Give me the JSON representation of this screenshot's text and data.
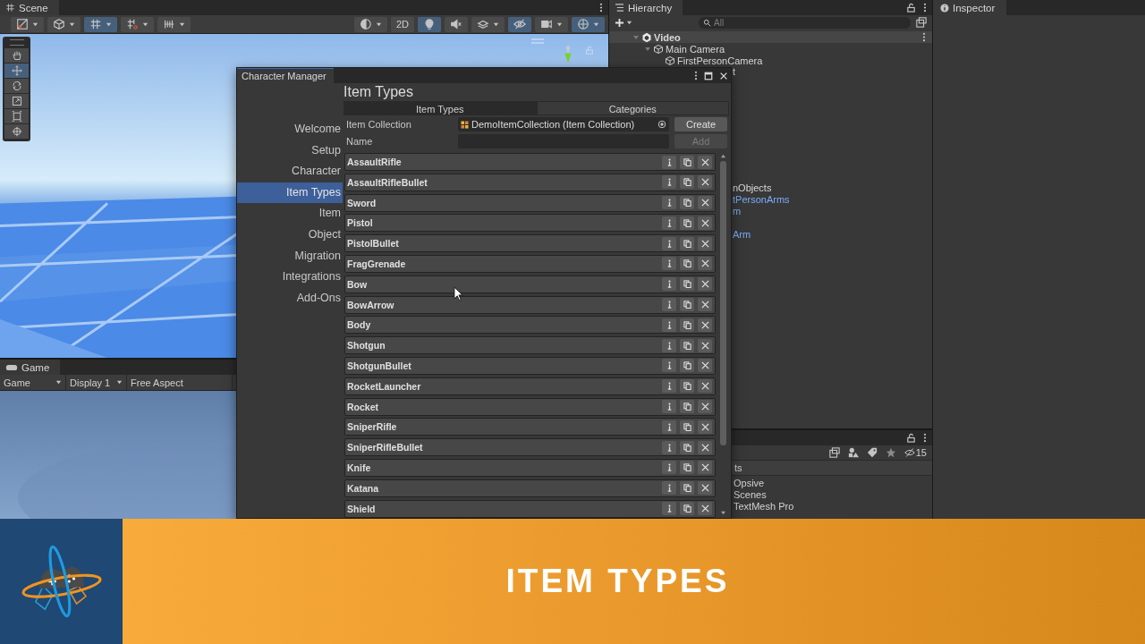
{
  "scene_panel": {
    "tab": "Scene",
    "toolbar": [
      {
        "kind": "icon",
        "dropdown": true,
        "on": false
      },
      {
        "kind": "icon",
        "dropdown": true,
        "on": false
      },
      {
        "kind": "icon",
        "dropdown": true,
        "on": true
      },
      {
        "kind": "icon",
        "dropdown": true,
        "on": false
      },
      {
        "kind": "icon",
        "dropdown": true,
        "on": false
      },
      {
        "kind": "icon",
        "dropdown": true,
        "on": false
      },
      {
        "kind": "text",
        "label": "2D",
        "dropdown": false,
        "on": false
      },
      {
        "kind": "icon",
        "dropdown": false,
        "on": true
      },
      {
        "kind": "icon",
        "dropdown": false,
        "on": false
      },
      {
        "kind": "icon",
        "dropdown": true,
        "on": false
      },
      {
        "kind": "icon",
        "dropdown": false,
        "on": true
      },
      {
        "kind": "icon",
        "dropdown": true,
        "on": false
      },
      {
        "kind": "icon",
        "dropdown": true,
        "on": true
      }
    ],
    "tools": [
      {
        "selected": false
      },
      {
        "selected": true
      },
      {
        "selected": false
      },
      {
        "selected": false
      },
      {
        "selected": false
      },
      {
        "selected": false
      }
    ]
  },
  "game_panel": {
    "tab": "Game",
    "view_menu": "Game",
    "display": "Display 1",
    "aspect": "Free Aspect"
  },
  "hierarchy": {
    "tab": "Hierarchy",
    "search": {
      "placeholder": "All"
    },
    "tree": [
      {
        "name": "Video",
        "kind": "scene",
        "expanded": true,
        "selected": true,
        "children": [
          {
            "name": "Main Camera",
            "kind": "object",
            "expanded": true,
            "selected": false,
            "children": [
              {
                "name": "FirstPersonCamera",
                "kind": "object",
                "selected": false
              }
            ]
          }
        ]
      }
    ],
    "covered_rows": [
      {
        "text": "t",
        "prefab": false
      },
      {
        "text": "nObjects",
        "prefab": false
      },
      {
        "text": "tPersonArms",
        "prefab": true
      },
      {
        "text": "m",
        "prefab": true
      },
      {
        "text": "Arm",
        "prefab": true
      }
    ]
  },
  "project": {
    "hidden_count": "15",
    "header": "ts",
    "folders": [
      "Opsive",
      "Scenes",
      "TextMesh Pro"
    ]
  },
  "inspector": {
    "tab": "Inspector"
  },
  "character_manager": {
    "title": "Character Manager",
    "nav": [
      {
        "label": "Welcome",
        "selected": false
      },
      {
        "label": "Setup",
        "selected": false
      },
      {
        "label": "Character",
        "selected": false
      },
      {
        "label": "Item Types",
        "selected": true
      },
      {
        "label": "Item",
        "selected": false
      },
      {
        "label": "Object",
        "selected": false
      },
      {
        "label": "Migration",
        "selected": false
      },
      {
        "label": "Integrations",
        "selected": false
      },
      {
        "label": "Add-Ons",
        "selected": false
      }
    ],
    "heading": "Item Types",
    "tabs": [
      {
        "label": "Item Types",
        "selected": true
      },
      {
        "label": "Categories",
        "selected": false
      }
    ],
    "collection": {
      "label": "Item Collection",
      "value": "DemoItemCollection (Item Collection)",
      "button": "Create"
    },
    "name_field": {
      "label": "Name",
      "button": "Add",
      "button_disabled": true
    },
    "items": [
      "AssaultRifle",
      "AssaultRifleBullet",
      "Sword",
      "Pistol",
      "PistolBullet",
      "FragGrenade",
      "Bow",
      "BowArrow",
      "Body",
      "Shotgun",
      "ShotgunBullet",
      "RocketLauncher",
      "Rocket",
      "SniperRifle",
      "SniperRifleBullet",
      "Knife",
      "Katana",
      "Shield"
    ]
  },
  "banner": {
    "title": "ITEM TYPES"
  }
}
